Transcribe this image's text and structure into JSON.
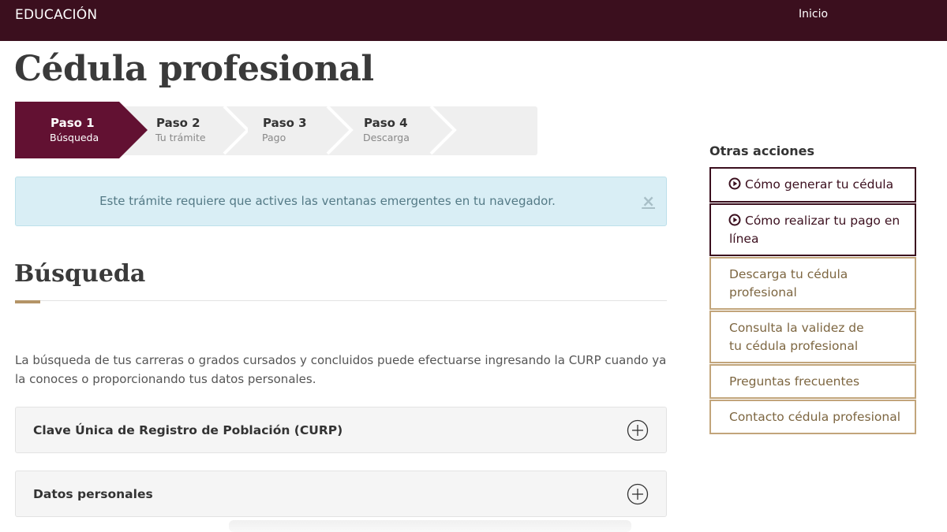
{
  "header": {
    "brand": "EDUCACIÓN",
    "nav_inicio": "Inicio"
  },
  "page": {
    "title": "Cédula profesional"
  },
  "stepper": {
    "steps": [
      {
        "title": "Paso 1",
        "subtitle": "Búsqueda",
        "active": true
      },
      {
        "title": "Paso 2",
        "subtitle": "Tu trámite",
        "active": false
      },
      {
        "title": "Paso 3",
        "subtitle": "Pago",
        "active": false
      },
      {
        "title": "Paso 4",
        "subtitle": "Descarga",
        "active": false
      }
    ]
  },
  "alert": {
    "text": "Este trámite requiere que actives las ventanas emergentes en tu navegador.",
    "close": "×"
  },
  "section": {
    "title": "Búsqueda",
    "intro": "La búsqueda de tus carreras o grados cursados y concluidos puede efectuarse ingresando la CURP cuando ya la conoces o proporcionando tus datos personales."
  },
  "accordion": {
    "items": [
      {
        "label": "Clave Única de Registro de Población (CURP)"
      },
      {
        "label": "Datos personales"
      }
    ]
  },
  "aside": {
    "title": "Otras acciones",
    "links": [
      {
        "label": "Cómo generar tu cédula",
        "icon": "play-circle-icon"
      },
      {
        "label": "Cómo realizar tu pago en línea",
        "icon": "play-circle-icon"
      },
      {
        "label": "Descarga tu cédula profesional"
      },
      {
        "label": "Consulta la validez de tu cédula profesional"
      },
      {
        "label": "Preguntas frecuentes"
      },
      {
        "label": "Contacto cédula profesional"
      }
    ]
  },
  "colors": {
    "brand_dark": "#3b0f1e",
    "step_active": "#621132",
    "accent_gold": "#b49467",
    "alert_bg": "#d9eef5"
  }
}
